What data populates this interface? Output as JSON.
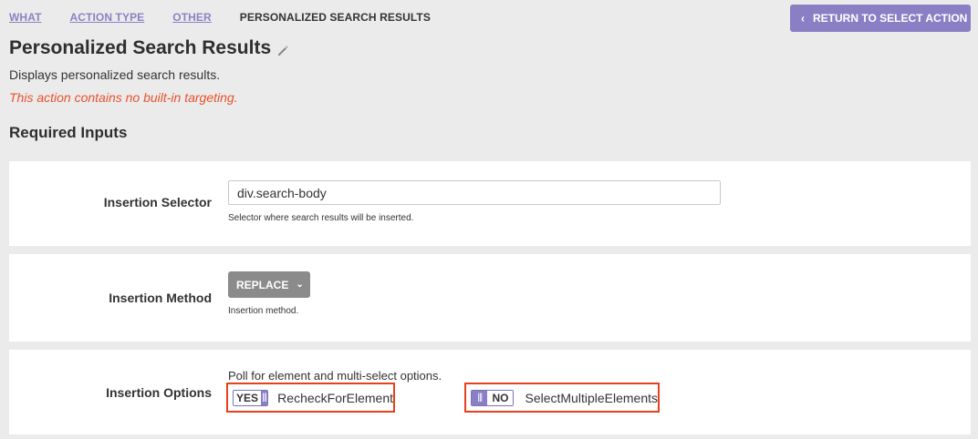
{
  "breadcrumb": {
    "items": [
      "WHAT",
      "ACTION TYPE",
      "OTHER"
    ],
    "current": "PERSONALIZED SEARCH RESULTS"
  },
  "return_button": {
    "label": "RETURN TO SELECT ACTION",
    "icon": "chevron-left-icon"
  },
  "page": {
    "title": "Personalized Search Results",
    "description": "Displays personalized search results.",
    "warning": "This action contains no built-in targeting.",
    "section_title": "Required Inputs"
  },
  "insertion_selector": {
    "label": "Insertion Selector",
    "value": "div.search-body",
    "help": "Selector where search results will be inserted."
  },
  "insertion_method": {
    "label": "Insertion Method",
    "value": "REPLACE",
    "help": "Insertion method."
  },
  "insertion_options": {
    "label": "Insertion Options",
    "help": "Poll for element and multi-select options.",
    "recheck": {
      "state": "YES",
      "label": "RecheckForElement"
    },
    "multiple": {
      "state": "NO",
      "label": "SelectMultipleElements"
    }
  },
  "colors": {
    "accent": "#8a7fc4",
    "warning": "#e8522e",
    "highlight_box": "#e8401e",
    "dropdown": "#8b8b8b"
  }
}
